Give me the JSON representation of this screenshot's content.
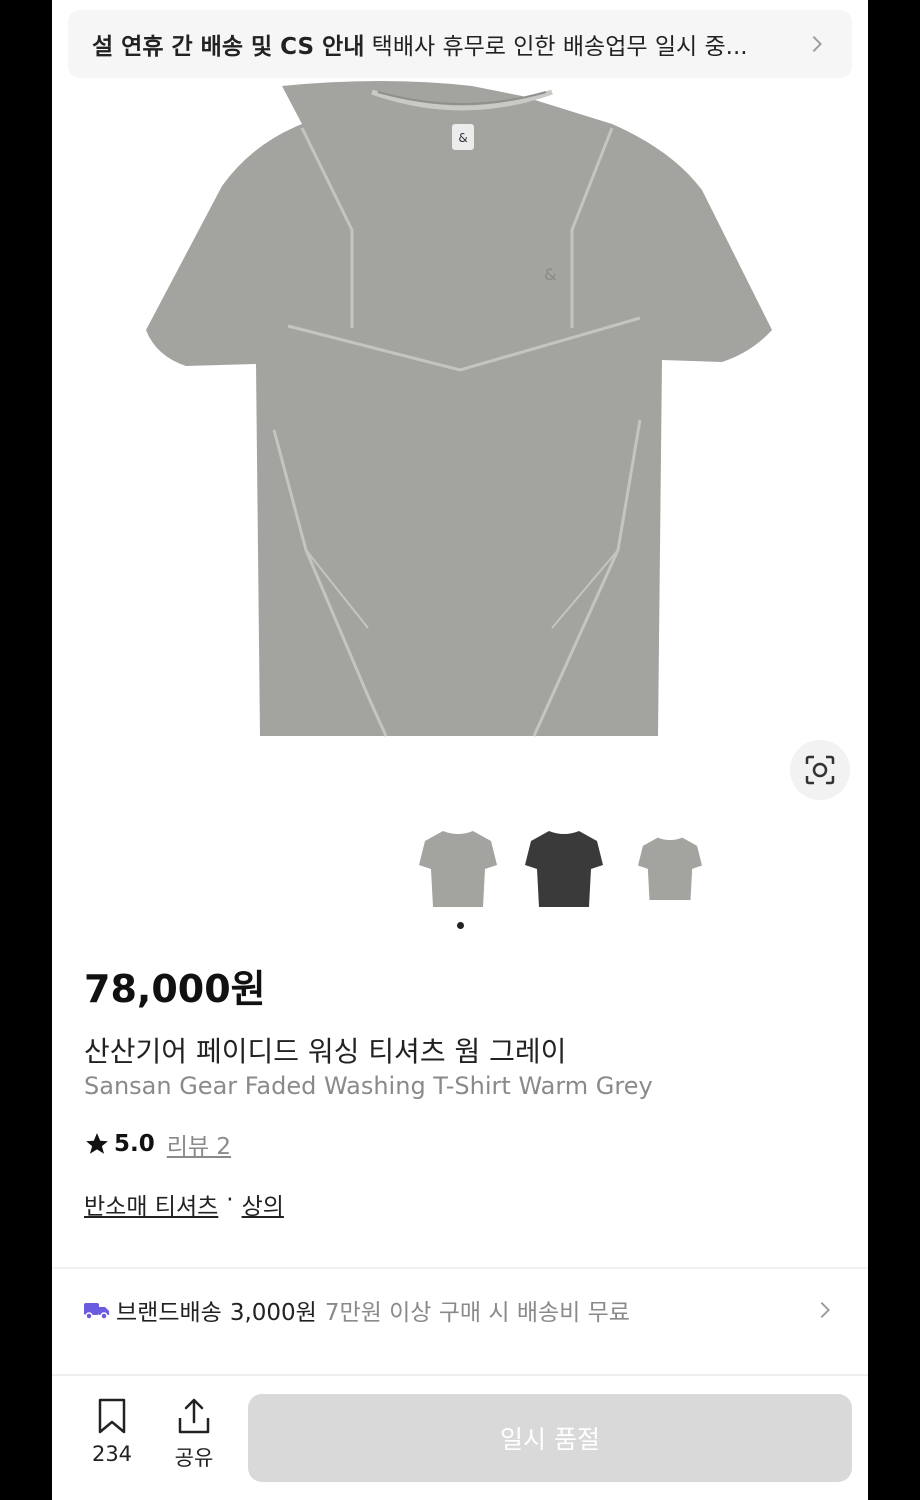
{
  "notice": {
    "bold_text": "설 연휴 간 배송 및 CS 안내",
    "text": "택배사 휴무로 인한 배송업무 일시 중...",
    "chevron_icon": "chevron-right-icon"
  },
  "product": {
    "image_icon": "gray-tshirt-image",
    "lens_icon": "image-search-icon",
    "thumbnails": [
      {
        "color": "#a3a3a0",
        "label": "gray-thumbnail"
      },
      {
        "color": "#3a3a3a",
        "label": "black-thumbnail"
      },
      {
        "color": "#a3a3a0",
        "label": "gray-thumbnail-small"
      }
    ],
    "active_thumbnail": 1,
    "price": "78,000원",
    "name_ko": "산산기어 페이디드 워싱 티셔츠 웜 그레이",
    "name_en": "Sansan Gear Faded Washing T-Shirt Warm Grey",
    "rating": "5.0",
    "review_label": "리뷰 2",
    "category_primary": "반소매 티셔츠",
    "category_separator": "·",
    "category_secondary": "상의"
  },
  "shipping": {
    "icon": "truck-icon",
    "icon_color": "#6b5be0",
    "label": "브랜드배송",
    "fee": "3,000원",
    "condition": "7만원 이상 구매 시 배송비 무료"
  },
  "bottom_bar": {
    "bookmark_icon": "bookmark-icon",
    "bookmark_count": "234",
    "share_icon": "share-icon",
    "share_label": "공유",
    "action_label": "일시 품절"
  },
  "colors": {
    "shirt_gray": "#a3a3a0",
    "button_disabled": "#d9d9d9"
  }
}
